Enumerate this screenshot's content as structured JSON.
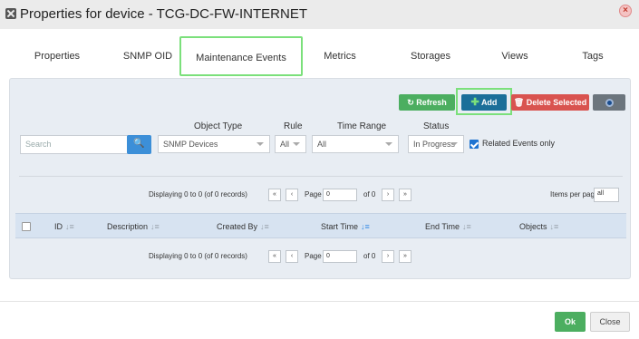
{
  "window": {
    "title": "Properties for device - TCG-DC-FW-INTERNET",
    "close_icon": "close-icon"
  },
  "tabs": [
    {
      "label": "Properties"
    },
    {
      "label": "SNMP OID"
    },
    {
      "label": "Maintenance Events",
      "active": true
    },
    {
      "label": "Metrics"
    },
    {
      "label": "Storages"
    },
    {
      "label": "Views"
    },
    {
      "label": "Tags"
    }
  ],
  "toolbar": {
    "refresh_label": "Refresh",
    "add_label": "Add",
    "delete_label": "Delete Selected",
    "gear_icon": "gear-icon"
  },
  "filters": {
    "search_placeholder": "Search",
    "object_type_label": "Object Type",
    "object_type_value": "SNMP Devices",
    "rule_label": "Rule",
    "rule_value": "All",
    "time_range_label": "Time Range",
    "time_range_value": "All",
    "status_label": "Status",
    "status_value": "In Progress",
    "related_label": "Related Events only",
    "related_checked": true
  },
  "pagination": {
    "display_text": "Displaying 0 to 0 (of 0 records)",
    "page_label": "Page",
    "page_value": "0",
    "of_text": "of 0",
    "items_per_page_label": "Items per page",
    "items_per_page_value": "all",
    "first_icon": "«",
    "prev_icon": "‹",
    "next_icon": "›",
    "last_icon": "»"
  },
  "table": {
    "columns": [
      {
        "label": "ID"
      },
      {
        "label": "Description"
      },
      {
        "label": "Created By"
      },
      {
        "label": "Start Time",
        "sorted": true
      },
      {
        "label": "End Time"
      },
      {
        "label": "Objects"
      }
    ],
    "rows": []
  },
  "footer": {
    "ok_label": "Ok",
    "close_label": "Close"
  },
  "colors": {
    "green": "#4cae60",
    "blue": "#1b6f99",
    "red": "#d9534f",
    "highlight": "#7be07b"
  }
}
